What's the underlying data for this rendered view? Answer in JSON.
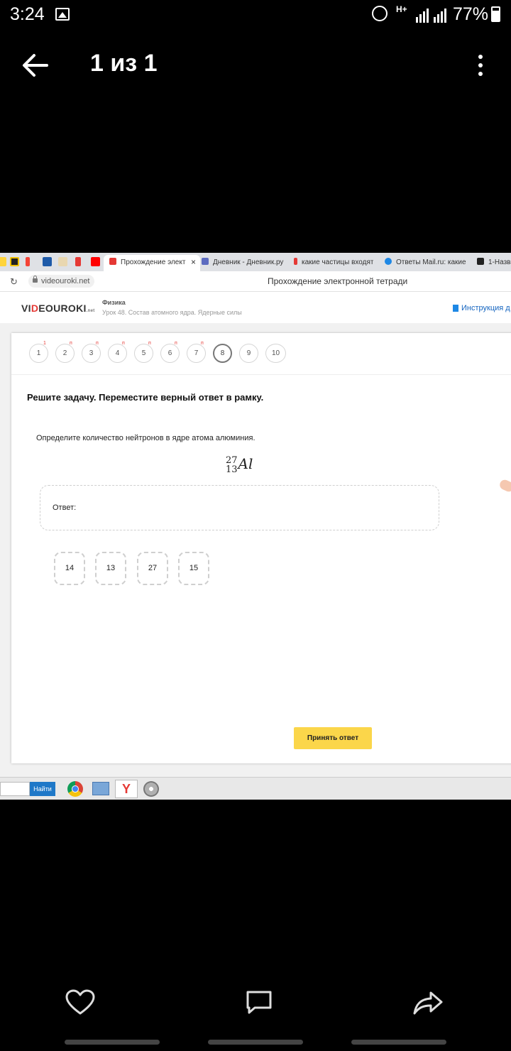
{
  "status_bar": {
    "time": "3:24",
    "network": "H+",
    "battery": "77%",
    "icons": [
      "gallery-icon",
      "alarm-icon",
      "signal-icon",
      "battery-icon"
    ]
  },
  "viewer": {
    "title": "1 из 1",
    "back_icon": "arrow-left",
    "menu_icon": "more-vertical"
  },
  "browser": {
    "pinned_tabs": [
      "pinned-tab",
      "pinned-tab",
      "pinned-tab",
      "pinned-tab",
      "pinned-tab",
      "pinned-tab",
      "pinned-tab",
      "pinned-tab"
    ],
    "tabs": [
      {
        "label": "Прохождение элект",
        "active": true,
        "close": "×"
      },
      {
        "label": "Дневник - Дневник.ру",
        "active": false
      },
      {
        "label": "какие частицы входят",
        "active": false
      },
      {
        "label": "Ответы Mail.ru: какие",
        "active": false
      },
      {
        "label": "1-Назва",
        "active": false
      }
    ],
    "url": "videouroki.net",
    "page_title": "Прохождение электронной тетради"
  },
  "site": {
    "logo_prefix": "VI",
    "logo_accent": "D",
    "logo_suffix": "EOUROKI",
    "logo_tld": ".net",
    "subject": "Физика",
    "lesson": "Урок 48. Состав атомного ядра. Ядерные силы",
    "instruction": "Инструкция д"
  },
  "quiz": {
    "questions": [
      {
        "number": "1",
        "mark": "1"
      },
      {
        "number": "2",
        "mark": "п"
      },
      {
        "number": "3",
        "mark": "п"
      },
      {
        "number": "4",
        "mark": "п"
      },
      {
        "number": "5",
        "mark": "п"
      },
      {
        "number": "6",
        "mark": "п"
      },
      {
        "number": "7",
        "mark": "п"
      },
      {
        "number": "8",
        "mark": ""
      },
      {
        "number": "9",
        "mark": ""
      },
      {
        "number": "10",
        "mark": ""
      }
    ],
    "current": "8",
    "instruction": "Решите задачу. Переместите верный ответ в рамку.",
    "question": "Определите количество нейтронов в ядре атома алюминия.",
    "formula": {
      "mass": "27",
      "atomic": "13",
      "symbol": "Al"
    },
    "answer_label": "Ответ:",
    "options": [
      "14",
      "13",
      "27",
      "15"
    ],
    "submit": "Принять ответ"
  },
  "taskbar": {
    "search_button": "Найти",
    "icons": [
      "chrome-icon",
      "network-icon",
      "yandex-icon",
      "disc-icon"
    ],
    "yandex_glyph": "Y"
  },
  "bottom_actions": [
    "heart-icon",
    "comment-icon",
    "share-icon"
  ],
  "colors": {
    "accent_yellow": "#fbd64a",
    "logo_red": "#e53935",
    "link_blue": "#1565c0"
  }
}
